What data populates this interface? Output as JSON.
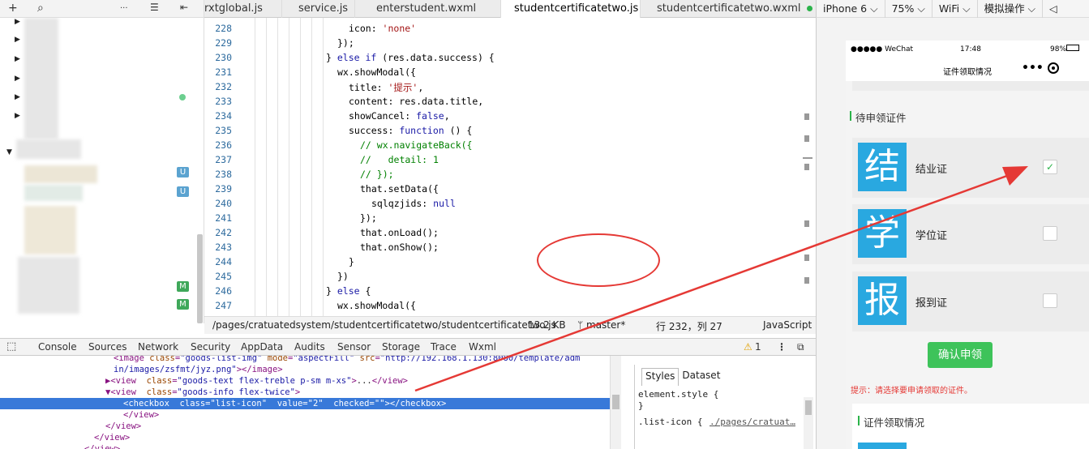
{
  "toolbar": {
    "icons": [
      "add-icon",
      "search-icon",
      "more-icon",
      "collapse-icon",
      "split-icon"
    ],
    "glyphs": [
      "+",
      "⌕",
      "···",
      "☰",
      "⇤"
    ]
  },
  "tabs": [
    {
      "label": "rxtglobal.js",
      "active": false
    },
    {
      "label": "service.js",
      "active": false
    },
    {
      "label": "enterstudent.wxml",
      "active": false
    },
    {
      "label": "studentcertificatetwo.js",
      "active": true
    },
    {
      "label": "studentcertificatetwo.wxml",
      "active": false,
      "modified": true
    }
  ],
  "simulator_bar": {
    "device": "iPhone 6 ⌵",
    "zoom": "75% ⌵",
    "network": "WiFi ⌵",
    "mode": "模拟操作 ⌵",
    "speaker": "◁"
  },
  "tree": {
    "badges": [
      "U",
      "U",
      "M",
      "M"
    ]
  },
  "editor": {
    "line_numbers": [
      "228",
      "229",
      "230",
      "231",
      "232",
      "233",
      "234",
      "235",
      "236",
      "237",
      "238",
      "239",
      "240",
      "241",
      "242",
      "243",
      "244",
      "245",
      "246",
      "247"
    ]
  },
  "status_bar": {
    "path": "/pages/cratuatedsystem/studentcertificatetwo/studentcertificatetwo.js",
    "size": "13.2 KB",
    "branch": "ᛘ master*",
    "position": "行 232，列 27",
    "language": "JavaScript"
  },
  "devtools": {
    "tabs": [
      "Console",
      "Sources",
      "Network",
      "Security",
      "AppData",
      "Audits",
      "Sensor",
      "Storage",
      "Trace",
      "Wxml"
    ],
    "warnings": "1",
    "styles_tabs": [
      "Styles",
      "Dataset"
    ],
    "styles_lines": [
      "element.style {",
      "}",
      ".list-icon {"
    ],
    "styles_link": "./pages/cratuat…"
  },
  "phone": {
    "carrier": "●●●●● WeChat",
    "time": "17:48",
    "battery": "98%",
    "title": "证件领取情况",
    "section_pending": "待申领证件",
    "certs": [
      {
        "glyph": "结",
        "name": "结业证",
        "checked": true
      },
      {
        "glyph": "学",
        "name": "学位证",
        "checked": false
      },
      {
        "glyph": "报",
        "name": "报到证",
        "checked": false
      }
    ],
    "confirm_button": "确认申领",
    "tip": "提示：请选择要申请领取的证件。",
    "section_status": "证件领取情况",
    "colors": {
      "accent": "#2bb34a",
      "icon_bg": "#29a8e0",
      "tip": "#e53935"
    }
  }
}
